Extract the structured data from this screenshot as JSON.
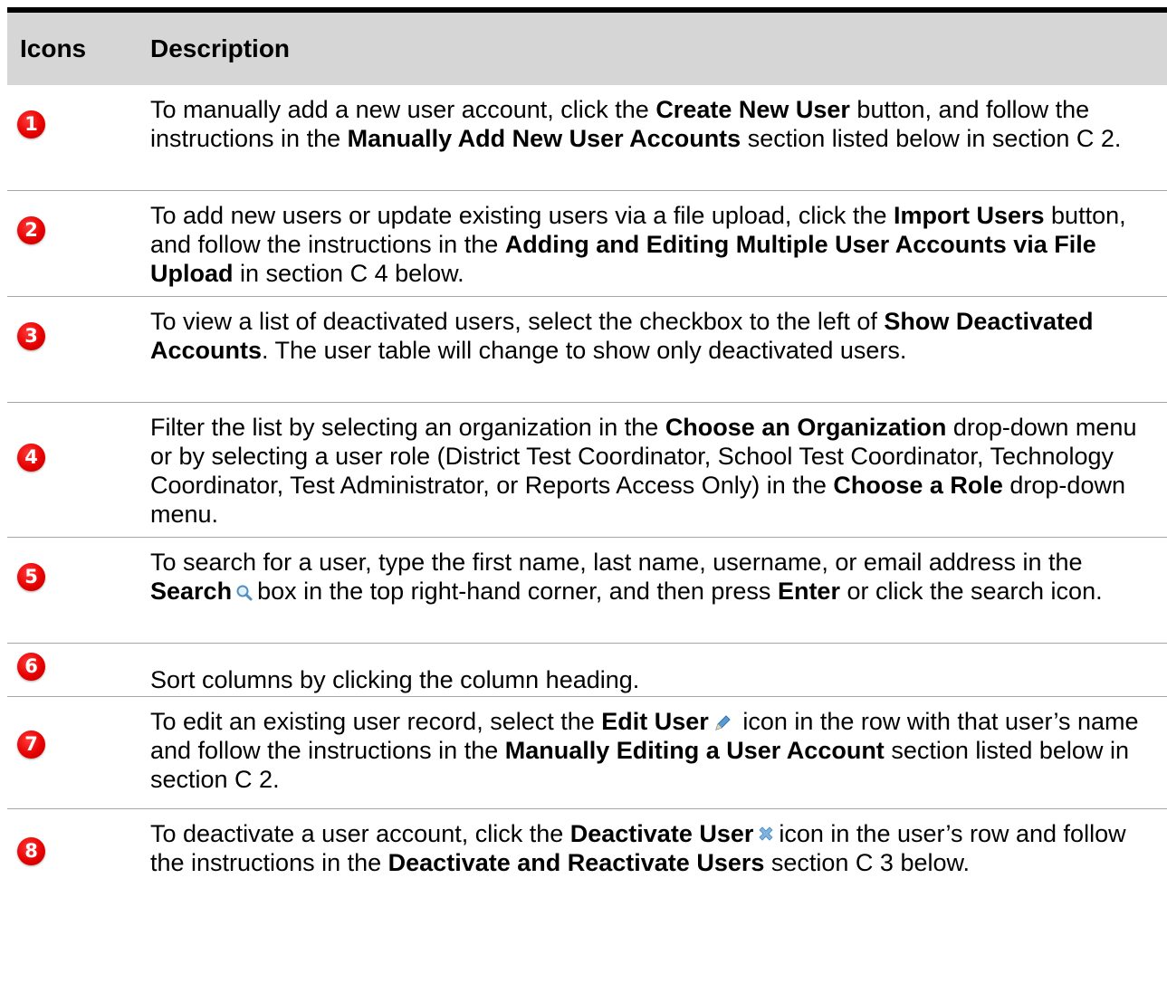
{
  "header": {
    "icons": "Icons",
    "description": "Description"
  },
  "rows": [
    {
      "badge": "1",
      "parts": [
        {
          "t": "To manually add a new user account, click the "
        },
        {
          "b": "Create New User"
        },
        {
          "t": " button, and follow the instructions in the "
        },
        {
          "b": "Manually Add New User Accounts"
        },
        {
          "t": " section listed below in section C 2."
        }
      ]
    },
    {
      "badge": "2",
      "parts": [
        {
          "t": "To add new users or update existing users via a file upload, click the "
        },
        {
          "b": "Import Users"
        },
        {
          "t": " button, and follow the instructions in the "
        },
        {
          "b": "Adding and Editing Multiple User Accounts via File Upload"
        },
        {
          "t": " in section C 4 below."
        }
      ]
    },
    {
      "badge": "3",
      "parts": [
        {
          "t": "To view a list of deactivated users, select the checkbox to the left of "
        },
        {
          "b": "Show Deactivated Accounts"
        },
        {
          "t": ". The user table will change to show only deactivated users."
        }
      ]
    },
    {
      "badge": "4",
      "parts": [
        {
          "t": "Filter the list by selecting an organization in the "
        },
        {
          "b": "Choose an Organization"
        },
        {
          "t": " drop-down menu or by selecting a user role (District Test Coordinator, School Test Coordinator, Technology Coordinator, Test Administrator, or Reports Access Only) in the "
        },
        {
          "b": "Choose a Role"
        },
        {
          "t": " drop-down menu."
        }
      ]
    },
    {
      "badge": "5",
      "parts": [
        {
          "t": "To search for a user, type the first name, last name, username, or email address in the "
        },
        {
          "b": "Search"
        },
        {
          "icon": "search-icon"
        },
        {
          "t": "box in the top right-hand corner, and then press "
        },
        {
          "b": "Enter"
        },
        {
          "t": " or click the search icon."
        }
      ]
    },
    {
      "badge": "6",
      "parts": [
        {
          "t": "Sort columns by clicking the column heading."
        }
      ]
    },
    {
      "badge": "7",
      "parts": [
        {
          "t": "To edit an existing user record, select the "
        },
        {
          "b": "Edit User"
        },
        {
          "icon": "pencil-icon"
        },
        {
          "t": " icon in the row with that user’s name and follow the instructions in the "
        },
        {
          "b": "Manually Editing a User Account"
        },
        {
          "t": " section listed below in section C 2."
        }
      ]
    },
    {
      "badge": "8",
      "parts": [
        {
          "t": "To deactivate a user account, click the "
        },
        {
          "b": "Deactivate User"
        },
        {
          "icon": "close-icon"
        },
        {
          "t": "icon in the user’s row and follow the instructions in the "
        },
        {
          "b": "Deactivate and Reactivate Users"
        },
        {
          "t": " section C 3 below."
        }
      ]
    }
  ],
  "colors": {
    "header_bg": "#d6d6d6",
    "badge_red": "#e80000",
    "rule": "#000000"
  }
}
